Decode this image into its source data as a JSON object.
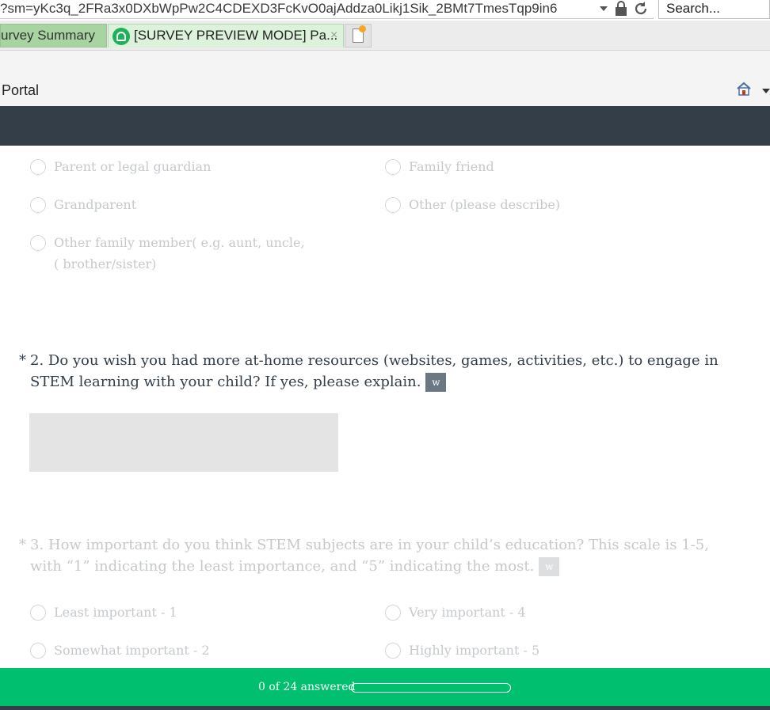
{
  "browser": {
    "url": "?sm=yKc3q_2FRa3x0DXbWpPw2C4CDEXD3FcKvO0ajAddza0Likj1Sik_2BMt7TmesTqp9in6",
    "search_placeholder": "Search...",
    "tabs": [
      {
        "label": "urvey Summary"
      },
      {
        "label": "[SURVEY PREVIEW MODE] Pa..."
      }
    ],
    "close_glyph": "×"
  },
  "toolbar": {
    "portal_label": "Portal"
  },
  "survey": {
    "q1_options": [
      {
        "label": "Parent or legal guardian"
      },
      {
        "label": "Family friend"
      },
      {
        "label": "Grandparent"
      },
      {
        "label": "Other (please describe)"
      },
      {
        "label_line1": "Other family member( e.g. aunt, uncle,",
        "label_line2": "( brother/sister)"
      }
    ],
    "q2": {
      "required": "*",
      "text": "2. Do you wish you had more at-home resources (websites, games, activities, etc.) to engage in STEM learning with your child? If yes, please explain.",
      "badge": "w"
    },
    "q3": {
      "required": "*",
      "text": "3. How important do you think STEM subjects are in your child’s education? This scale is 1-5, with “1” indicating the least importance, and “5” indicating the most.",
      "badge": "w",
      "options": [
        {
          "label": "Least important - 1"
        },
        {
          "label": "Very important - 4"
        },
        {
          "label": "Somewhat important - 2"
        },
        {
          "label": "Highly important - 5"
        }
      ]
    }
  },
  "progress": {
    "text": "0 of 24 answered",
    "answered": 0,
    "total": 24,
    "fraction": 0
  },
  "colors": {
    "accent": "#00bf6f",
    "header_dark": "#333e48"
  }
}
